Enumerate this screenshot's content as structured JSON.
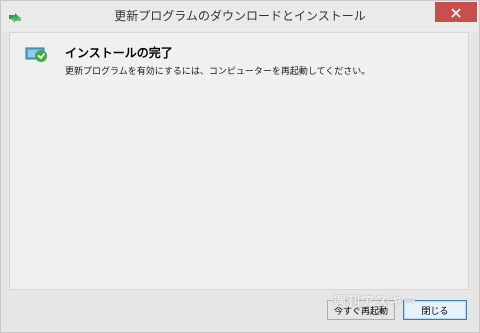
{
  "window": {
    "title": "更新プログラムのダウンロードとインストール",
    "app_icon": "windows-update-icon",
    "close_icon": "close-icon"
  },
  "content": {
    "status_icon": "install-complete-icon",
    "heading": "インストールの完了",
    "message": "更新プログラムを有効にするには、コンピューターを再起動してください。"
  },
  "buttons": {
    "restart_label": "今すぐ再起動",
    "close_label": "閉じる"
  },
  "watermark": "週刊アスキー",
  "colors": {
    "close_button_bg": "#c7504f",
    "default_button_border": "#3c7fb1"
  }
}
